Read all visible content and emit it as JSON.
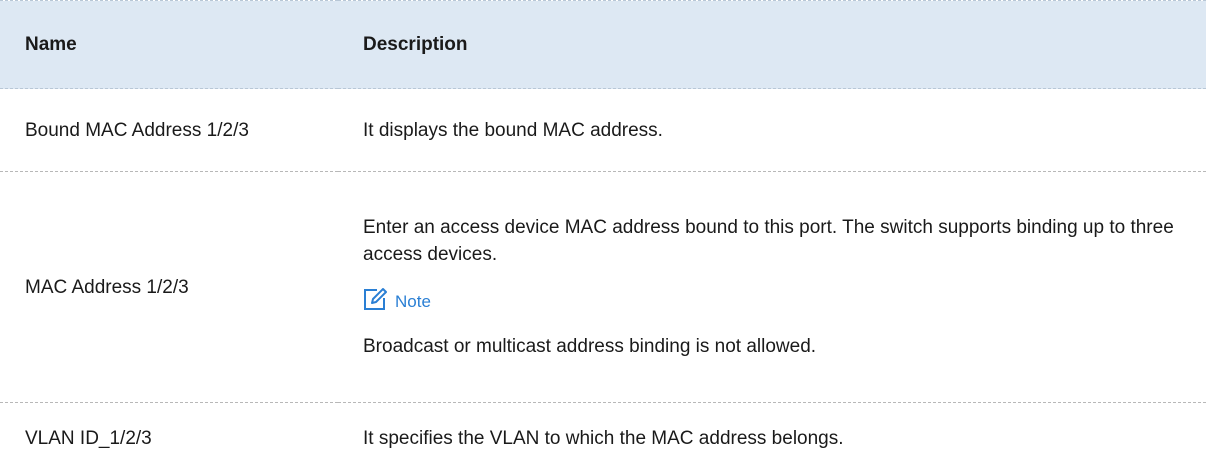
{
  "table": {
    "headers": [
      "Name",
      "Description"
    ],
    "rows": [
      {
        "name": "Bound MAC Address 1/2/3",
        "description": "It displays the bound MAC address."
      },
      {
        "name": "MAC Address 1/2/3",
        "description": "Enter an access device MAC address bound to this port. The switch supports binding up to three access devices.",
        "note_label": "Note",
        "note_text": "Broadcast or multicast address binding is not allowed."
      },
      {
        "name": "VLAN ID_1/2/3",
        "description": "It specifies the VLAN to which the MAC address belongs."
      }
    ]
  },
  "icons": {
    "note": "note-edit-icon"
  },
  "colors": {
    "header_bg": "#dde8f3",
    "note_accent": "#2a7fd4"
  }
}
